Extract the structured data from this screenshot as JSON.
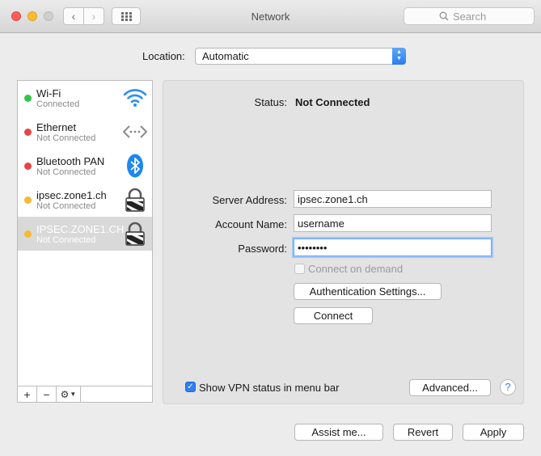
{
  "window": {
    "title": "Network",
    "search_placeholder": "Search"
  },
  "location": {
    "label": "Location:",
    "value": "Automatic"
  },
  "services": [
    {
      "name": "Wi-Fi",
      "status": "Connected",
      "dot_color": "#2fc843",
      "icon": "wifi-icon",
      "selected": false
    },
    {
      "name": "Ethernet",
      "status": "Not Connected",
      "dot_color": "#e94444",
      "icon": "ethernet-icon",
      "selected": false
    },
    {
      "name": "Bluetooth PAN",
      "status": "Not Connected",
      "dot_color": "#e94444",
      "icon": "bluetooth-icon",
      "selected": false
    },
    {
      "name": "ipsec.zone1.ch",
      "status": "Not Connected",
      "dot_color": "#f6b92f",
      "icon": "vpn-lock-icon",
      "selected": false
    },
    {
      "name": "IPSEC.ZONE1.CH",
      "status": "Not Connected",
      "dot_color": "#f6b92f",
      "icon": "vpn-lock-icon",
      "selected": true
    }
  ],
  "tools": {
    "add": "+",
    "remove": "−",
    "gear": "⚙"
  },
  "detail": {
    "status_label": "Status:",
    "status_value": "Not Connected",
    "server_label": "Server Address:",
    "server_value": "ipsec.zone1.ch",
    "account_label": "Account Name:",
    "account_value": "username",
    "password_label": "Password:",
    "password_value": "secret12",
    "connect_on_demand": "Connect on demand",
    "auth_button": "Authentication Settings...",
    "connect_button": "Connect",
    "show_vpn_status": "Show VPN status in menu bar",
    "advanced_button": "Advanced...",
    "help": "?"
  },
  "footer": {
    "assist": "Assist me...",
    "revert": "Revert",
    "apply": "Apply"
  }
}
